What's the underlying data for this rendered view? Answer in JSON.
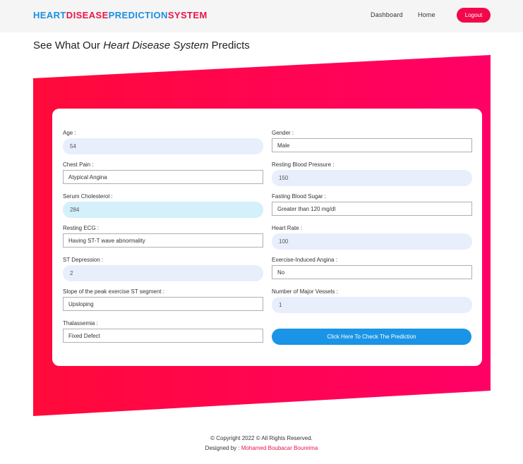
{
  "navbar": {
    "brand_part1": "HEART",
    "brand_part2": "DISEASE",
    "brand_part3": "PREDICTION",
    "brand_part4": "SYSTEM",
    "links": [
      "Dashboard",
      "Home"
    ],
    "logout_label": "Logout"
  },
  "heading": {
    "prefix": "See What Our ",
    "emphasis": "Heart Disease System",
    "suffix": " Predicts"
  },
  "form": {
    "age": {
      "label": "Age :",
      "value": "54"
    },
    "gender": {
      "label": "Gender :",
      "value": "Male"
    },
    "chest_pain": {
      "label": "Chest Pain :",
      "value": "Atypical Angina"
    },
    "resting_bp": {
      "label": "Resting Blood Pressure :",
      "value": "150"
    },
    "cholesterol": {
      "label": "Serum Cholesterol :",
      "value": "284"
    },
    "fasting_sugar": {
      "label": "Fasting Blood Sugar :",
      "value": "Greater than 120 mg/dl"
    },
    "resting_ecg": {
      "label": "Resting ECG :",
      "value": "Having ST-T wave abnormality"
    },
    "heart_rate": {
      "label": "Heart Rate :",
      "value": "100"
    },
    "st_depression": {
      "label": "ST Depression :",
      "value": "2"
    },
    "angina": {
      "label": "Exercise-Induced Angina :",
      "value": "No"
    },
    "slope": {
      "label": "Slope of the peak exercise ST segment :",
      "value": "Upsloping"
    },
    "vessels": {
      "label": "Number of Major Vessels :",
      "value": "1"
    },
    "thalassemia": {
      "label": "Thalassemia :",
      "value": "Fixed Defect"
    },
    "submit_label": "Click Here To Check The Prediction"
  },
  "footer": {
    "copyright": "© Copyright 2022 © All Rights Reserved.",
    "designed_by": "Designed by : ",
    "author": "Mohamed Boubacar Boureima"
  },
  "colors": {
    "brand_blue": "#1a8fe3",
    "brand_red": "#e8164a",
    "hero_gradient_start": "#ff0a3a",
    "hero_gradient_end": "#ff0066",
    "button_blue": "#1a94e6"
  }
}
